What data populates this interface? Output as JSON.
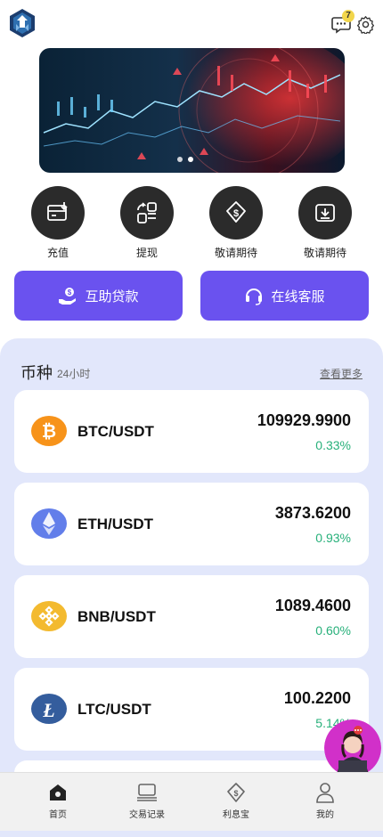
{
  "header": {
    "message_badge": "7"
  },
  "quick_actions": [
    {
      "label": "充值",
      "icon": "deposit-icon"
    },
    {
      "label": "提现",
      "icon": "withdraw-icon"
    },
    {
      "label": "敬请期待",
      "icon": "coming-soon-dollar-icon"
    },
    {
      "label": "敬请期待",
      "icon": "coming-soon-download-icon"
    }
  ],
  "buttons": {
    "loan": "互助贷款",
    "service": "在线客服"
  },
  "market": {
    "title": "币种",
    "subtitle": "24小时",
    "more": "查看更多",
    "items": [
      {
        "pair": "BTC/USDT",
        "price": "109929.9900",
        "change": "0.33%",
        "icon": "btc-icon",
        "color": "#f7931a"
      },
      {
        "pair": "ETH/USDT",
        "price": "3873.6200",
        "change": "0.93%",
        "icon": "eth-icon",
        "color": "#627eea"
      },
      {
        "pair": "BNB/USDT",
        "price": "1089.4600",
        "change": "0.60%",
        "icon": "bnb-icon",
        "color": "#f3ba2f"
      },
      {
        "pair": "LTC/USDT",
        "price": "100.2200",
        "change": "5.14%",
        "icon": "ltc-icon",
        "color": "#345d9d"
      }
    ],
    "positive_color": "#27b07a"
  },
  "tabbar": [
    {
      "label": "首页",
      "icon": "home-icon"
    },
    {
      "label": "交易记录",
      "icon": "records-icon"
    },
    {
      "label": "利息宝",
      "icon": "interest-icon"
    },
    {
      "label": "我的",
      "icon": "user-icon"
    }
  ],
  "colors": {
    "accent": "#6a52ef",
    "panel": "#e2e7fb"
  }
}
